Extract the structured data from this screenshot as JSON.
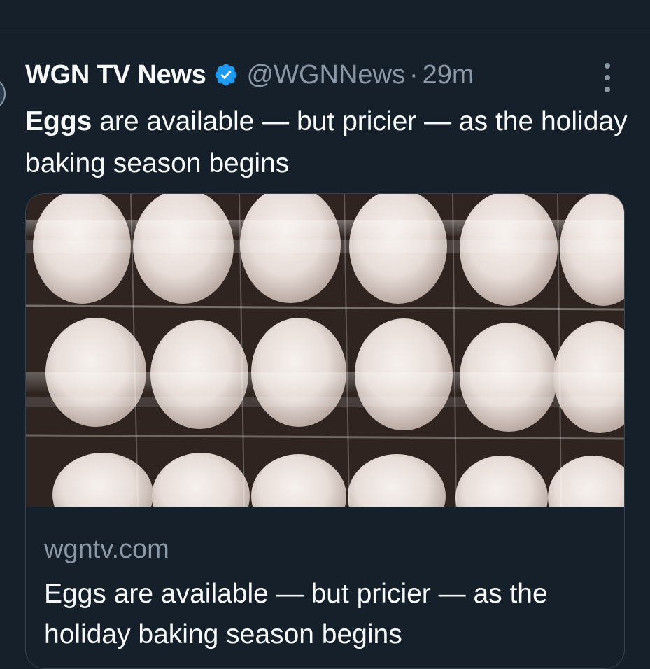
{
  "tweet": {
    "author_name": "WGN TV News",
    "handle": "@WGNNews",
    "separator": "·",
    "time": "29m",
    "text_bold": "Eggs",
    "text_rest": " are available — but pricier — as the holiday baking season begins"
  },
  "card": {
    "image_icon": "eggs-in-cartons-photo",
    "domain": "wgntv.com",
    "title": "Eggs are available — but pricier — as the holiday baking season begins"
  },
  "icons": {
    "verified": "verified-badge-icon",
    "more": "more-options-icon"
  },
  "colors": {
    "background": "#15202b",
    "text_primary": "#f7f9f9",
    "text_secondary": "#8b98a5",
    "verified_blue": "#1d9bf0",
    "border": "#38444d"
  }
}
